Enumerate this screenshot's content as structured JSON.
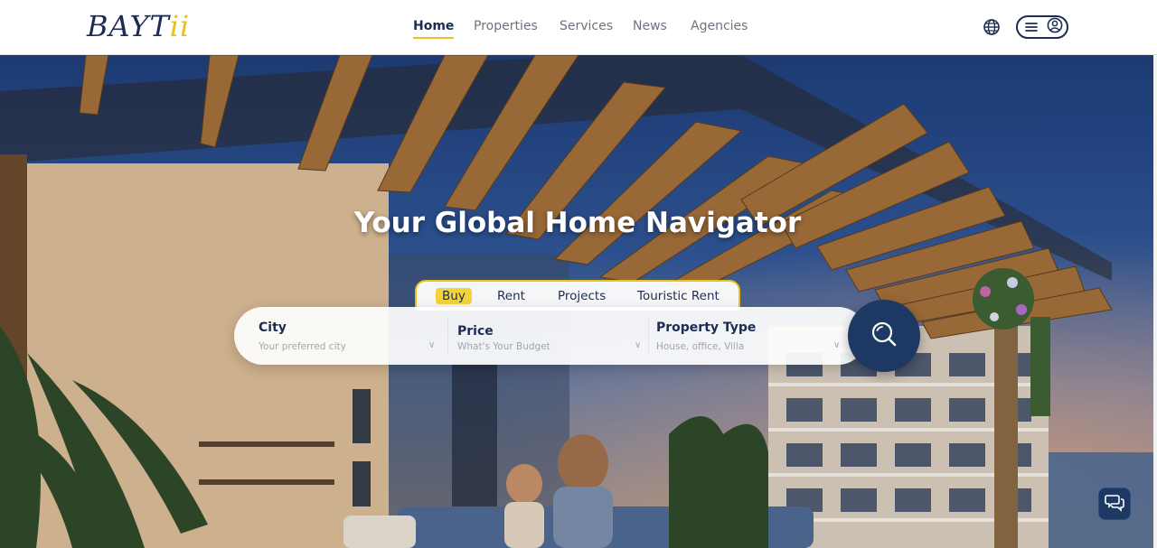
{
  "brand": {
    "logo_main": "BAYT",
    "logo_accent": "ii"
  },
  "nav": {
    "items": [
      {
        "label": "Home",
        "active": true
      },
      {
        "label": "Properties",
        "active": false
      },
      {
        "label": "Services",
        "active": false
      },
      {
        "label": "News",
        "active": false
      },
      {
        "label": "Agencies",
        "active": false
      }
    ]
  },
  "header_icons": {
    "language": "globe-icon",
    "menu": "hamburger-icon",
    "account": "user-circle-icon"
  },
  "hero": {
    "headline": "Your Global Home Navigator"
  },
  "search": {
    "tabs": [
      {
        "label": "Buy",
        "active": true
      },
      {
        "label": "Rent",
        "active": false
      },
      {
        "label": "Projects",
        "active": false
      },
      {
        "label": "Touristic Rent",
        "active": false
      }
    ],
    "fields": [
      {
        "label": "City",
        "placeholder": "Your preferred city"
      },
      {
        "label": "Price",
        "placeholder": "What's Your Budget"
      },
      {
        "label": "Property Type",
        "placeholder": "House, office, Villa"
      }
    ],
    "button_icon": "search-icon"
  },
  "chat": {
    "icon": "chat-bubbles-icon"
  },
  "colors": {
    "brand_navy": "#1b2d55",
    "accent_yellow": "#e8c21a",
    "button_navy": "#1c3863"
  }
}
